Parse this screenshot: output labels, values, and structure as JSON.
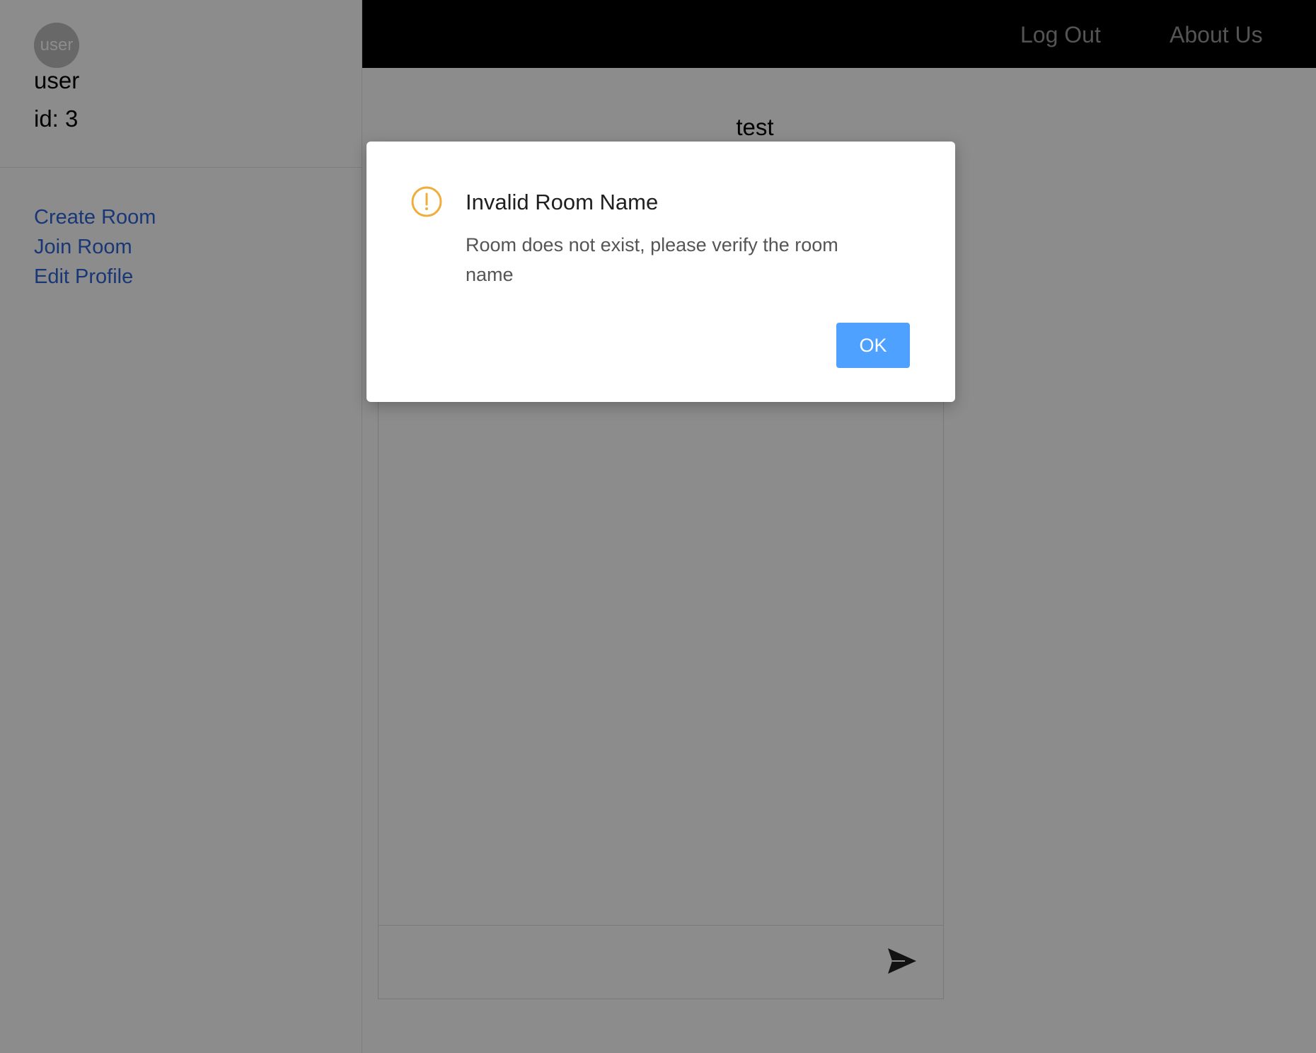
{
  "sidebar": {
    "avatar_text": "user",
    "username": "user",
    "user_id": "id: 3",
    "nav": [
      {
        "label": "Create Room"
      },
      {
        "label": "Join Room"
      },
      {
        "label": "Edit Profile"
      }
    ]
  },
  "topbar": {
    "logout_label": "Log Out",
    "about_label": "About Us"
  },
  "room": {
    "title": "test",
    "message_placeholder": ""
  },
  "dialog": {
    "title": "Invalid Room Name",
    "message": "Room does not exist, please verify the room name",
    "ok_label": "OK",
    "icon": "warning-icon"
  },
  "colors": {
    "link": "#2f64d8",
    "warning": "#f0ad3c",
    "ok_button": "#4ea1ff",
    "topbar": "#000000"
  }
}
